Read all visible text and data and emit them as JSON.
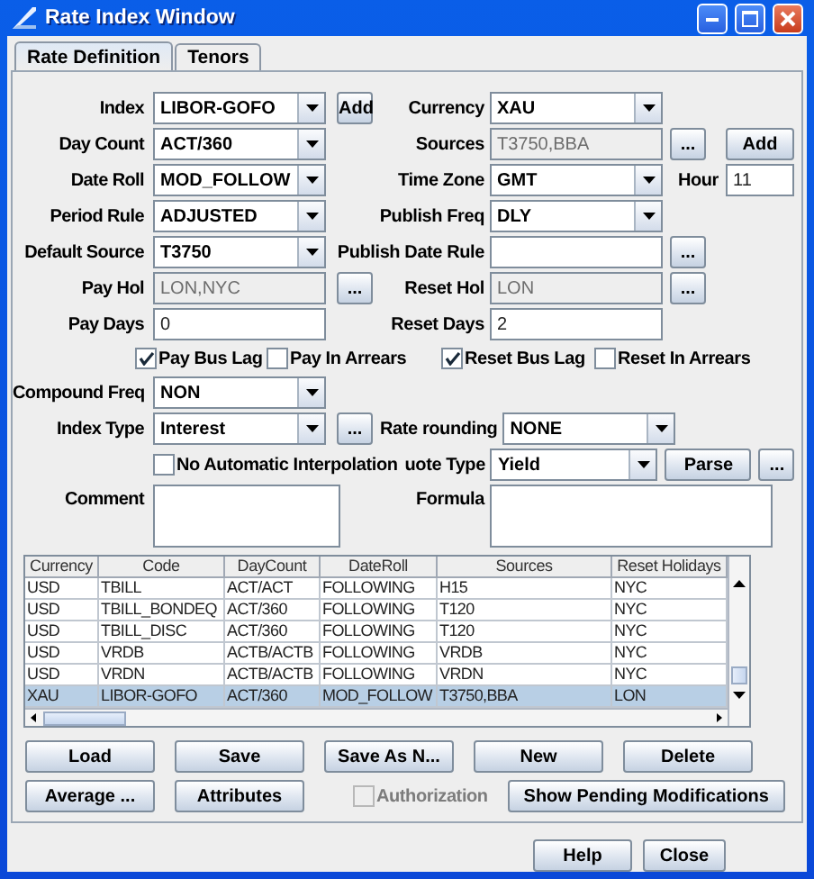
{
  "window": {
    "title": "Rate Index Window"
  },
  "tabs": [
    {
      "label": "Rate Definition",
      "selected": true
    },
    {
      "label": "Tenors",
      "selected": false
    }
  ],
  "form_rows": [
    {
      "kind": "fields",
      "left": {
        "label": "Index",
        "kind": "combo",
        "value": "LIBOR-GOFO",
        "buttons": [
          "Add"
        ]
      },
      "right": {
        "label": "Currency",
        "kind": "combo",
        "value": "XAU"
      }
    },
    {
      "kind": "fields",
      "left": {
        "label": "Day Count",
        "kind": "combo",
        "value": "ACT/360"
      },
      "right": {
        "label": "Sources",
        "kind": "readonly",
        "value": "T3750,BBA",
        "buttons": [
          "..."
        ]
      },
      "extra": {
        "kind": "button",
        "label": "Add"
      }
    },
    {
      "kind": "fields",
      "left": {
        "label": "Date Roll",
        "kind": "combo",
        "value": "MOD_FOLLOW"
      },
      "right": {
        "label": "Time Zone",
        "kind": "combo",
        "value": "GMT"
      },
      "extra": {
        "kind": "field",
        "label": "Hour",
        "value": "11"
      }
    },
    {
      "kind": "fields",
      "left": {
        "label": "Period Rule",
        "kind": "combo",
        "value": "ADJUSTED"
      },
      "right": {
        "label": "Publish Freq",
        "kind": "combo",
        "value": "DLY"
      }
    },
    {
      "kind": "fields",
      "left": {
        "label": "Default Source",
        "kind": "combo",
        "value": "T3750"
      },
      "right": {
        "label": "Publish Date Rule",
        "kind": "text",
        "buttons": [
          "..."
        ]
      }
    },
    {
      "kind": "fields",
      "left": {
        "label": "Pay Hol",
        "kind": "readonly",
        "value": "LON,NYC",
        "buttons": [
          "..."
        ]
      },
      "right": {
        "label": "Reset Hol",
        "kind": "readonly",
        "value": "LON",
        "buttons": [
          "..."
        ]
      }
    },
    {
      "kind": "fields",
      "left": {
        "label": "Pay Days",
        "kind": "text",
        "value": "0"
      },
      "right": {
        "label": "Reset Days",
        "kind": "text",
        "value": "2"
      }
    },
    {
      "kind": "checks",
      "items": [
        {
          "label": "Pay Bus Lag",
          "checked": true
        },
        {
          "label": "Pay In Arrears",
          "checked": false
        },
        {
          "label": "Reset Bus Lag",
          "checked": true
        },
        {
          "label": "Reset In Arrears",
          "checked": false
        }
      ]
    },
    {
      "kind": "fields",
      "left": {
        "label": "Compound Freq",
        "kind": "combo",
        "value": "NON"
      }
    },
    {
      "kind": "fields",
      "left": {
        "label": "Index Type",
        "kind": "combo",
        "value": "Interest",
        "buttons": [
          "..."
        ]
      },
      "right": {
        "label": "Rate rounding",
        "kind": "combo",
        "value": "NONE"
      }
    },
    {
      "kind": "fields",
      "left": {
        "kind": "checkbox",
        "value": "No Automatic Interpolation",
        "checked": false
      },
      "right": {
        "label": "uote Type",
        "kind": "combo",
        "value": "Yield",
        "buttons": [
          "Parse",
          "..."
        ]
      }
    },
    {
      "kind": "fields",
      "left": {
        "label": "Comment",
        "kind": "textarea"
      },
      "right": {
        "label": "Formula",
        "kind": "textarea"
      }
    }
  ],
  "table": {
    "columns": [
      "Currency",
      "Code",
      "DayCount",
      "DateRoll",
      "Sources",
      "Reset Holidays"
    ],
    "rows": [
      {
        "cells": [
          "USD",
          "TBILL",
          "ACT/ACT",
          "FOLLOWING",
          "H15",
          "NYC"
        ],
        "selected": false
      },
      {
        "cells": [
          "USD",
          "TBILL_BONDEQ",
          "ACT/360",
          "FOLLOWING",
          "T120",
          "NYC"
        ],
        "selected": false
      },
      {
        "cells": [
          "USD",
          "TBILL_DISC",
          "ACT/360",
          "FOLLOWING",
          "T120",
          "NYC"
        ],
        "selected": false
      },
      {
        "cells": [
          "USD",
          "VRDB",
          "ACTB/ACTB",
          "FOLLOWING",
          "VRDB",
          "NYC"
        ],
        "selected": false
      },
      {
        "cells": [
          "USD",
          "VRDN",
          "ACTB/ACTB",
          "FOLLOWING",
          "VRDN",
          "NYC"
        ],
        "selected": false
      },
      {
        "cells": [
          "XAU",
          "LIBOR-GOFO",
          "ACT/360",
          "MOD_FOLLOW",
          "T3750,BBA",
          "LON"
        ],
        "selected": true
      }
    ]
  },
  "action_rows": [
    [
      {
        "kind": "button",
        "label": "Load"
      },
      {
        "kind": "button",
        "label": "Save"
      },
      {
        "kind": "button",
        "label": "Save As N..."
      },
      {
        "kind": "button",
        "label": "New"
      },
      {
        "kind": "button",
        "label": "Delete"
      }
    ],
    [
      {
        "kind": "button",
        "label": "Average ..."
      },
      {
        "kind": "button",
        "label": "Attributes"
      },
      {
        "kind": "checkbox",
        "label": "Authorization",
        "checked": false,
        "disabled": true
      },
      {
        "kind": "wide",
        "label": "Show Pending Modifications"
      }
    ]
  ],
  "footer_buttons": [
    "Help",
    "Close"
  ]
}
